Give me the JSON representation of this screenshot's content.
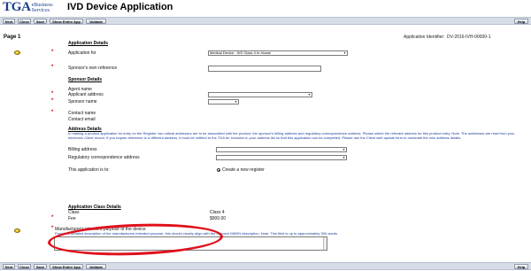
{
  "header": {
    "logo_text": "TGA",
    "logo_sub1": "eBusiness",
    "logo_sub2": "Services",
    "title": "IVD Device Application"
  },
  "toolbar": {
    "buttons": [
      "Next",
      "Close",
      "Save",
      "Show Entire App",
      "Validate"
    ],
    "help": "Help"
  },
  "page": {
    "label": "Page 1",
    "app_id_label": "Application Identifier:",
    "app_id_value": "DV-2016-IVH-00000-1"
  },
  "application_details": {
    "heading": "Application Details",
    "application_for_label": "Application for",
    "application_for_value": "Medical Device - IVD Class 4 In-House",
    "sponsor_ref_label": "Sponsor's own reference"
  },
  "sponsor_details": {
    "heading": "Sponsor Details",
    "agent_name_label": "Agent name",
    "applicant_address_label": "Applicant address",
    "sponsor_name_label": "Sponsor name",
    "contact_name_label": "Contact name",
    "contact_email_label": "Contact email"
  },
  "address_details": {
    "heading": "Address Details",
    "description": "In making a product application for entry on the Register, two critical addresses are to be associated with the product: the sponsor's billing address and regulatory correspondence address. Please select the relevant address for this product entry. Note: The addresses are read from your electronic Client record. If you require reference to a different address, it must be notified to the TGA for inclusion in your address list so that this application can be completed. Please use the Client web update form to nominate the new address details.",
    "billing_label": "Billing address",
    "regulatory_label": "Regulatory correspondence address",
    "app_is_to_label": "This application is to:",
    "app_is_to_option": "Create a new register"
  },
  "class_details": {
    "heading": "Application Class Details",
    "class_label": "Class",
    "class_value": "Class 4",
    "fee_label": "Fee",
    "fee_value": "$900.00",
    "purpose_label": "Manufacturer's intended purpose of the device",
    "purpose_hint": "Provide a detailed description of the manufacturers intended purpose, this should closely align with the relevant GMDN description. Note: This field is up to approximately 300 words."
  },
  "colors": {
    "required": "#cc1111",
    "annotation": "#e0101a",
    "toolbar": "#d7dde6",
    "brand": "#1b3f8b"
  }
}
